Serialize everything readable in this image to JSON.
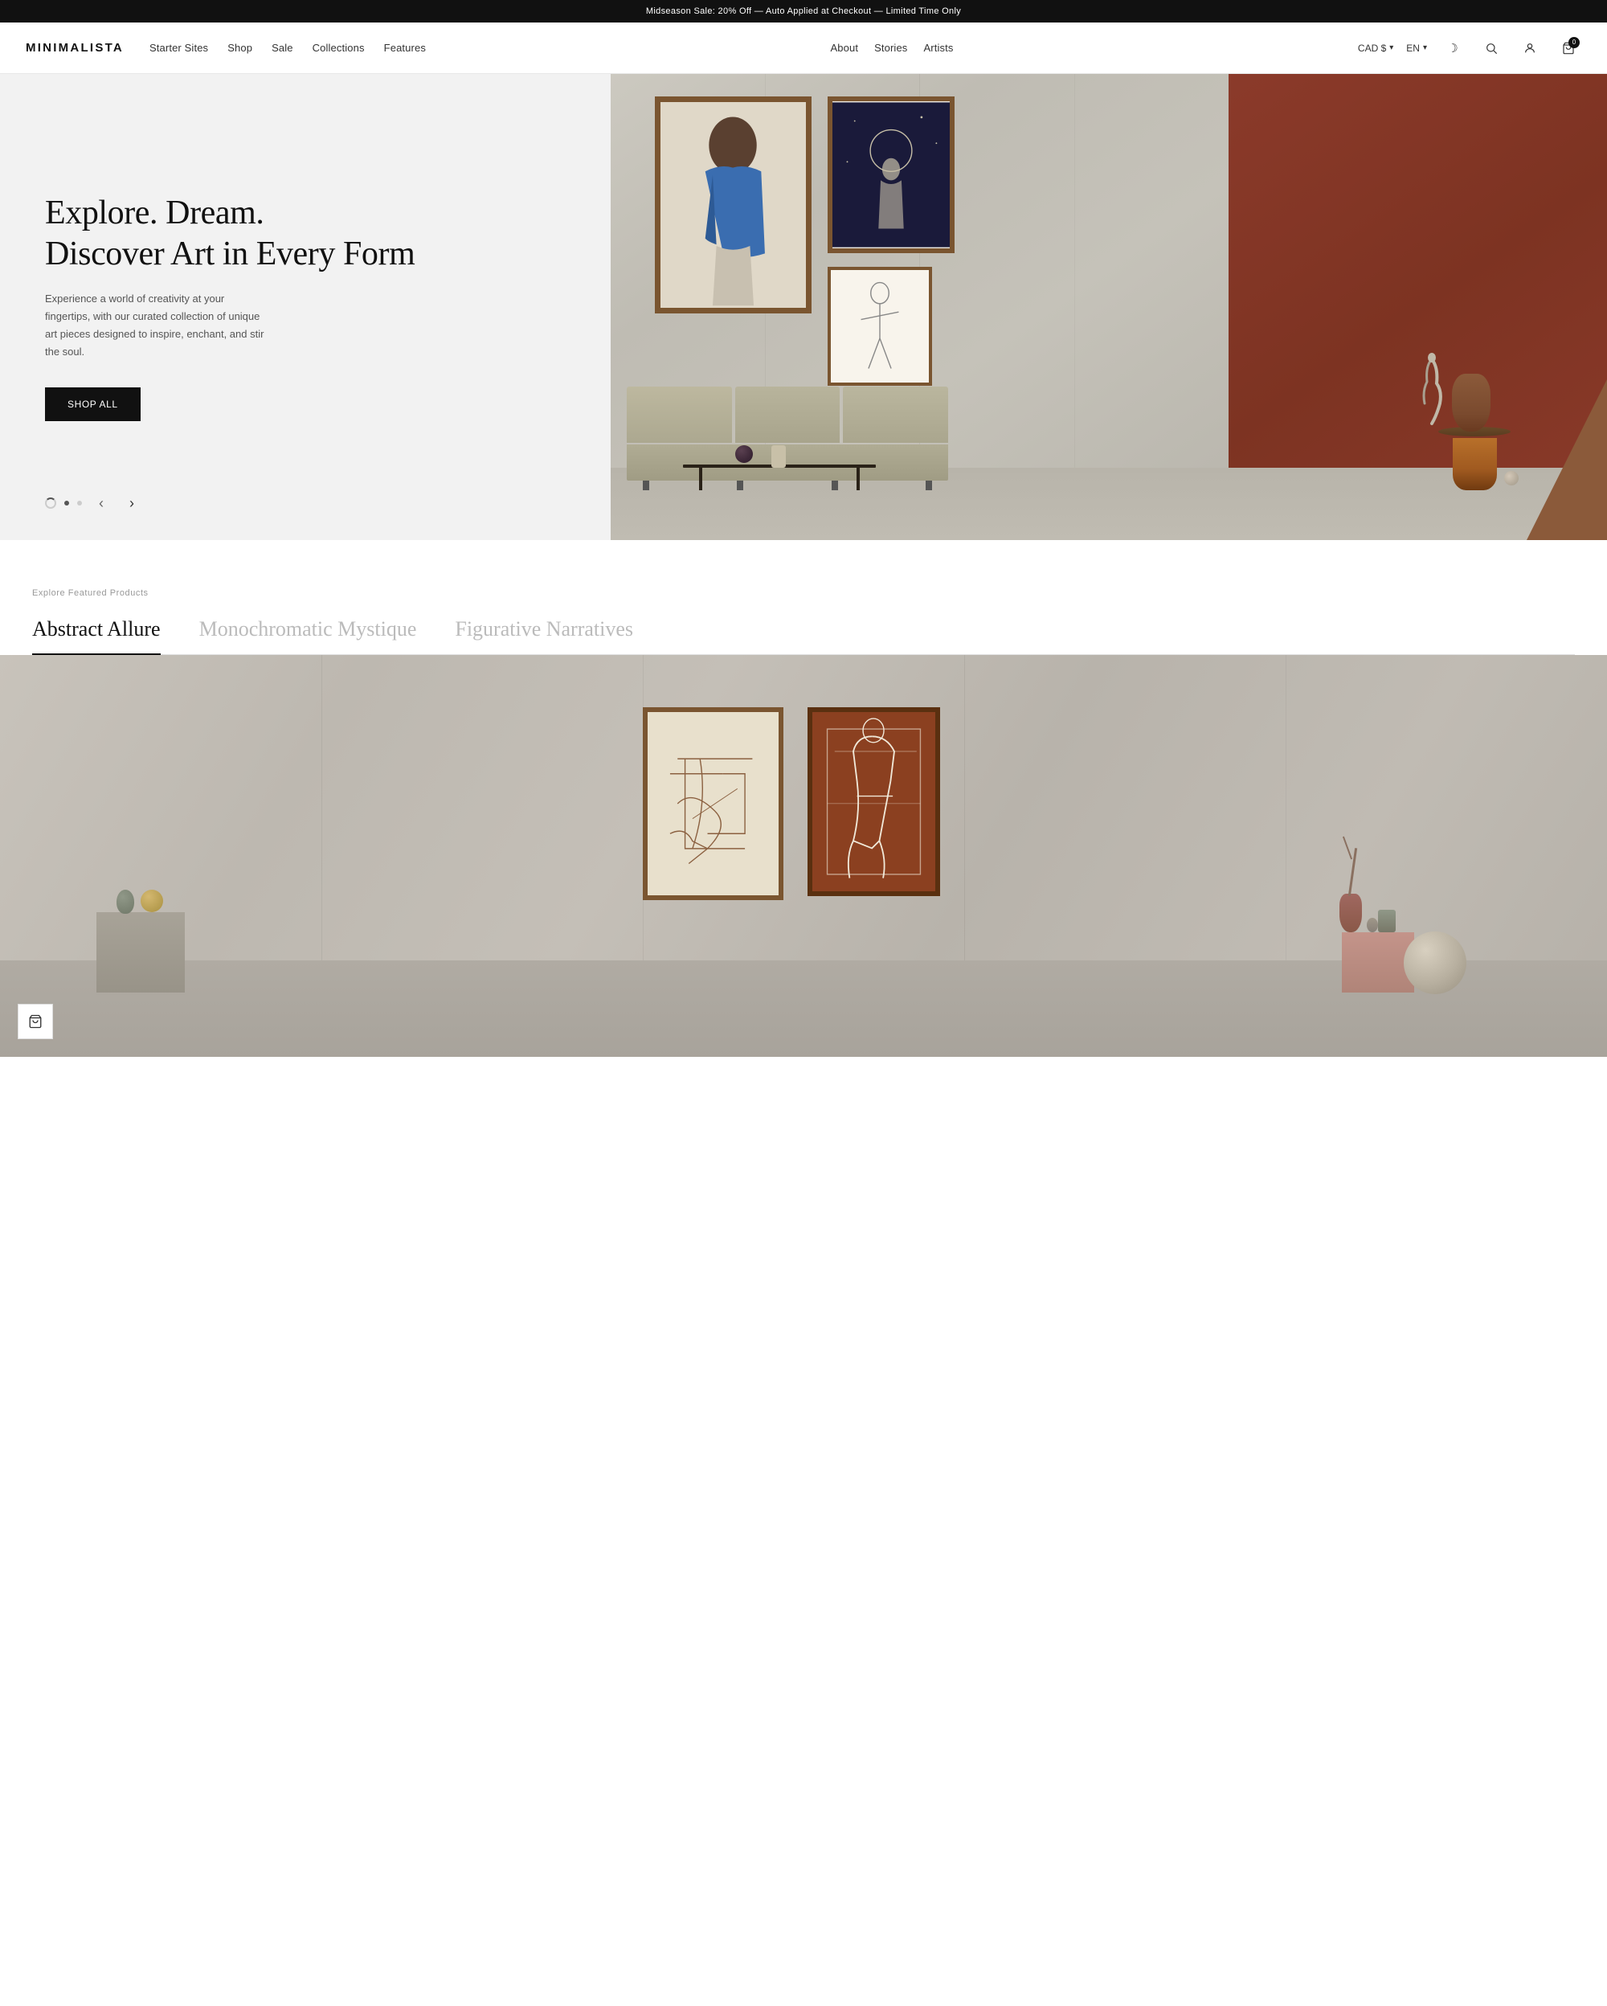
{
  "announcement": {
    "text": "Midseason Sale: 20% Off — Auto Applied at Checkout — Limited Time Only"
  },
  "header": {
    "logo": "MINIMALISTA",
    "nav_primary": [
      {
        "label": "Starter Sites",
        "id": "starter-sites"
      },
      {
        "label": "Shop",
        "id": "shop"
      },
      {
        "label": "Sale",
        "id": "sale"
      },
      {
        "label": "Collections",
        "id": "collections"
      },
      {
        "label": "Features",
        "id": "features"
      }
    ],
    "nav_secondary": [
      {
        "label": "About",
        "id": "about"
      },
      {
        "label": "Stories",
        "id": "stories"
      },
      {
        "label": "Artists",
        "id": "artists"
      }
    ],
    "currency": "CAD $",
    "language": "EN",
    "cart_count": "0"
  },
  "hero": {
    "title_line1": "Explore. Dream.",
    "title_line2": "Discover Art in Every Form",
    "description": "Experience a world of creativity at your fingertips, with our curated collection of unique art pieces designed to inspire, enchant, and stir the soul.",
    "cta_label": "Shop All",
    "slide_current": 1,
    "slide_total": 2
  },
  "featured": {
    "section_label": "Explore Featured Products",
    "tabs": [
      {
        "label": "Abstract Allure",
        "active": true
      },
      {
        "label": "Monochromatic Mystique",
        "active": false
      },
      {
        "label": "Figurative Narratives",
        "active": false
      }
    ]
  },
  "icons": {
    "moon": "☽",
    "search": "⌕",
    "user": "○",
    "cart": "⊡",
    "chevron_down": "▾",
    "arrow_left": "‹",
    "arrow_right": "›",
    "shopping_bag": "⊡"
  }
}
